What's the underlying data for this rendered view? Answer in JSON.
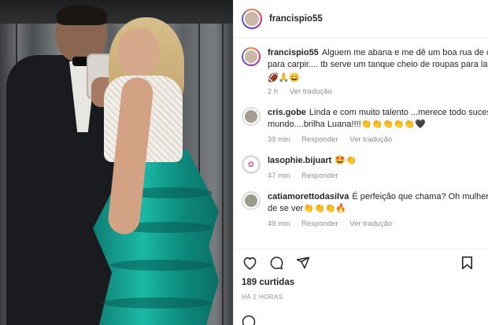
{
  "post": {
    "username": "francispio55",
    "avatar_icon": "profile-avatar",
    "caption": {
      "username": "francispio55",
      "line1": "Alguem me abana e me dê um boa rua de cafez",
      "line2": "para carpir.... tb serve um tanque cheio de roupas para lavar",
      "emoji": "🏈🙏😄",
      "time": "2 h",
      "translate": "Ver tradução"
    },
    "comments": [
      {
        "username": "cris.gobe",
        "text1": "Linda e com muito talento ...merece todo sucesso c",
        "text2": "mundo....brilha Luana!!!!👏👏👏👏👏🖤",
        "time": "39 min",
        "reply": "Responder",
        "translate": "Ver tradução"
      },
      {
        "username": "lasophie.bijuart",
        "text1": "🤩👏",
        "time": "47 min",
        "reply": "Responder"
      },
      {
        "username": "catiamorettodasilva",
        "text1": "É perfeição que chama? Oh mulher linda",
        "text2": "de se ver👏👏👏🔥",
        "time": "49 min",
        "reply": "Responder",
        "translate": "Ver tradução"
      }
    ],
    "likes": "189 curtidas",
    "posted": "HÁ 2 HORAS"
  }
}
